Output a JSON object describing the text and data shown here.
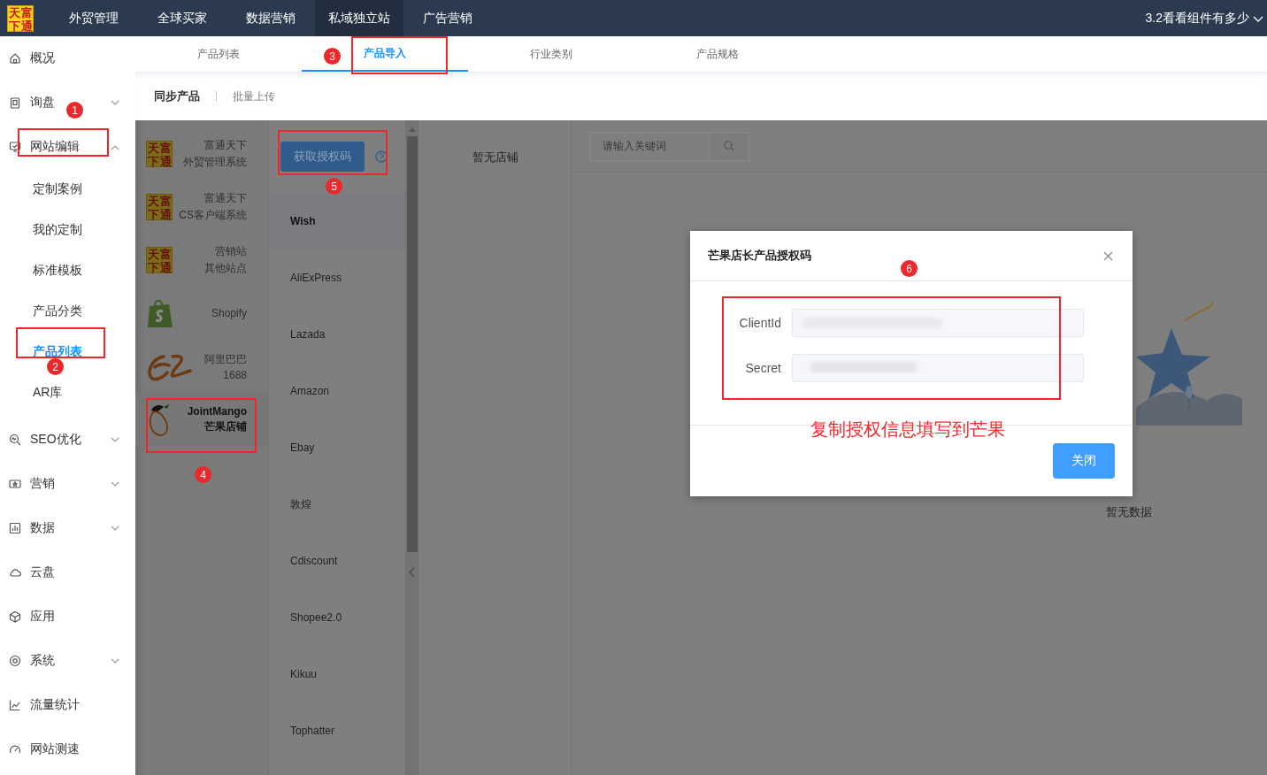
{
  "header": {
    "logo_text": "天富下通",
    "nav": [
      {
        "label": "外贸管理",
        "selected": false
      },
      {
        "label": "全球买家",
        "selected": false
      },
      {
        "label": "数据营销",
        "selected": false
      },
      {
        "label": "私域独立站",
        "selected": true
      },
      {
        "label": "广告营销",
        "selected": false
      }
    ],
    "user": "3.2看看组件有多少"
  },
  "sidebar": {
    "items": [
      {
        "label": "概况"
      },
      {
        "label": "询盘",
        "expanded": false
      },
      {
        "label": "网站编辑",
        "expanded": true,
        "children": [
          {
            "label": "定制案例",
            "selected": false
          },
          {
            "label": "我的定制",
            "selected": false
          },
          {
            "label": "标准模板",
            "selected": false
          },
          {
            "label": "产品分类",
            "selected": false
          },
          {
            "label": "产品列表",
            "selected": true
          },
          {
            "label": "AR库",
            "selected": false
          }
        ]
      },
      {
        "label": "SEO优化",
        "expanded": false
      },
      {
        "label": "营销",
        "expanded": false
      },
      {
        "label": "数据",
        "expanded": false
      },
      {
        "label": "云盘"
      },
      {
        "label": "应用"
      },
      {
        "label": "系统",
        "expanded": false
      },
      {
        "label": "流量统计"
      },
      {
        "label": "网站测速"
      }
    ]
  },
  "tabs": [
    {
      "label": "产品列表",
      "selected": false
    },
    {
      "label": "产品导入",
      "selected": true
    },
    {
      "label": "行业类别",
      "selected": false
    },
    {
      "label": "产品规格",
      "selected": false
    }
  ],
  "subtabs": [
    {
      "label": "同步产品",
      "selected": true
    },
    {
      "label": "批量上传",
      "selected": false
    }
  ],
  "platforms": [
    {
      "kind": "tianfu",
      "logo_text": "天富下通",
      "lines": [
        "富通天下",
        "外贸管理系统"
      ],
      "selected": false
    },
    {
      "kind": "tianfu",
      "logo_text": "天富下通",
      "lines": [
        "富通天下",
        "CS客户端系统"
      ],
      "selected": false
    },
    {
      "kind": "tianfu",
      "logo_text": "天富下通",
      "lines": [
        "营销站",
        "其他站点"
      ],
      "selected": false
    },
    {
      "kind": "shopify",
      "lines": [
        "Shopify"
      ],
      "selected": false
    },
    {
      "kind": "alibaba",
      "lines": [
        "阿里巴巴",
        "1688"
      ],
      "selected": false
    },
    {
      "kind": "mango",
      "lines": [
        "JointMango",
        "芒果店铺"
      ],
      "selected": true
    }
  ],
  "auth_button": "获取授权码",
  "channels": [
    {
      "label": "Wish",
      "selected": true
    },
    {
      "label": "AliExPress",
      "selected": false
    },
    {
      "label": "Lazada",
      "selected": false
    },
    {
      "label": "Amazon",
      "selected": false
    },
    {
      "label": "Ebay",
      "selected": false
    },
    {
      "label": "敦煌",
      "selected": false
    },
    {
      "label": "Cdiscount",
      "selected": false
    },
    {
      "label": "Shopee2.0",
      "selected": false
    },
    {
      "label": "Kikuu",
      "selected": false
    },
    {
      "label": "Tophatter",
      "selected": false
    }
  ],
  "stores_empty": "暂无店铺",
  "search": {
    "placeholder": "请输入关键词"
  },
  "empty_text": "暂无数据",
  "modal": {
    "title": "芒果店长产品授权码",
    "fields": [
      {
        "label": "ClientId"
      },
      {
        "label": "Secret"
      }
    ],
    "button": "关闭"
  },
  "annotations": {
    "markers": [
      "1",
      "2",
      "3",
      "4",
      "5",
      "6"
    ],
    "note": "复制授权信息填写到芒果"
  }
}
